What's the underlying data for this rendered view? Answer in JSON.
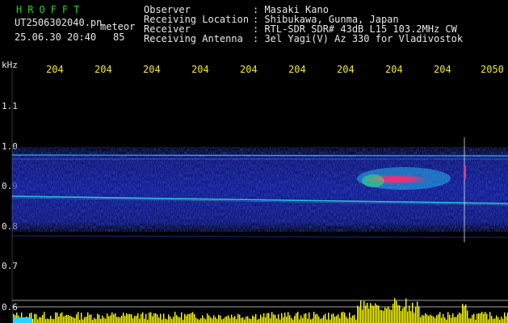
{
  "header": {
    "app_name": "HROFFT",
    "filename": "UT2506302040.pn",
    "mode": "meteor",
    "datetime": "25.06.30 20:40",
    "counter": "85",
    "info_labels": [
      "Observer",
      "Receiving Location",
      "Receiver",
      "Receiving Antenna"
    ],
    "info_values": [
      ": Masaki Kano",
      ": Shibukawa, Gunma, Japan",
      ": RTL-SDR SDR# 43dB L15 103.2MHz CW",
      ": 3el Yagi(V) Az 330 for Vladivostok"
    ]
  },
  "axis": {
    "unit": "kHz",
    "y_ticks": [
      "1.1",
      "1.0",
      "0.9",
      "0.8",
      "0.7",
      "0.6"
    ],
    "x_ticks": [
      "204",
      "204",
      "204",
      "204",
      "204",
      "204",
      "204",
      "204",
      "204",
      "2050"
    ]
  },
  "colors": {
    "background": "#000000",
    "header_text": "#e8e8e8",
    "app_name": "#25d22a",
    "tick_text": "#f2e82a",
    "band": "#1a26c8",
    "signal": "#2ad2ff",
    "echo": "#ff2a6e",
    "bars": "#ffff00"
  }
}
